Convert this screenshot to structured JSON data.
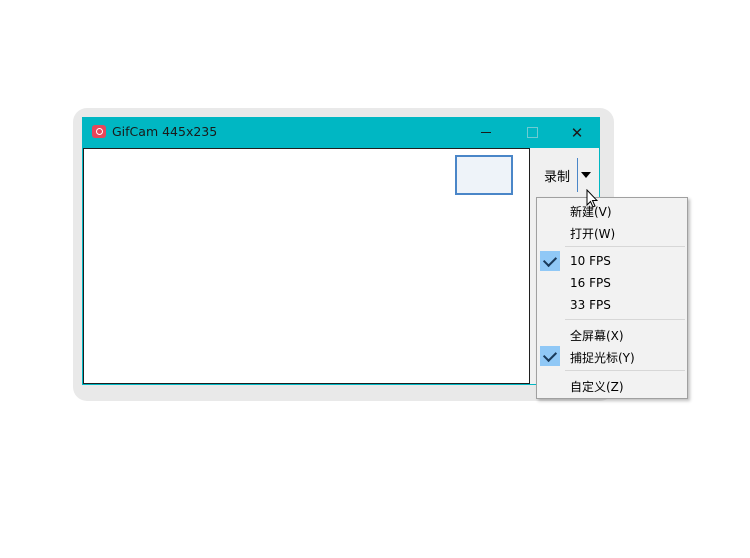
{
  "window": {
    "title": "GifCam 445x235",
    "minimize_glyph": "—",
    "close_glyph": "✕"
  },
  "record": {
    "label": "录制"
  },
  "menu": {
    "items": [
      {
        "label": "新建(V)",
        "checked": false
      },
      {
        "label": "打开(W)",
        "checked": false
      },
      {
        "label": "10 FPS",
        "checked": true
      },
      {
        "label": "16 FPS",
        "checked": false
      },
      {
        "label": "33 FPS",
        "checked": false
      },
      {
        "label": "全屏幕(X)",
        "checked": false
      },
      {
        "label": "捕捉光标(Y)",
        "checked": true
      },
      {
        "label": "自定义(Z)",
        "checked": false
      }
    ]
  },
  "colors": {
    "titlebar": "#00b7c3",
    "check_highlight": "#90c8f6"
  },
  "icons": {
    "app": "camera-icon",
    "dropdown": "triangle-down-icon",
    "check": "checkmark-icon",
    "cursor": "mouse-pointer-icon"
  }
}
